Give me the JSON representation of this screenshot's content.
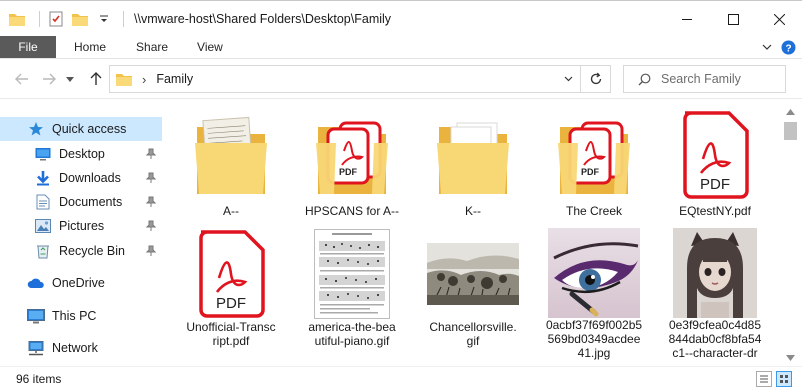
{
  "window": {
    "title": "\\\\vmware-host\\Shared Folders\\Desktop\\Family",
    "controls": [
      "minimize-icon",
      "maximize-icon",
      "close-icon"
    ]
  },
  "ribbon": {
    "tabs": [
      {
        "label": "File",
        "active": true
      },
      {
        "label": "Home"
      },
      {
        "label": "Share"
      },
      {
        "label": "View"
      }
    ]
  },
  "address": {
    "crumb": "Family",
    "separator": "›"
  },
  "search": {
    "placeholder": "Search Family"
  },
  "nav": {
    "items": [
      {
        "label": "Quick access",
        "icon": "star-icon",
        "selected": true
      },
      {
        "label": "Desktop",
        "icon": "desktop-icon",
        "pinned": true
      },
      {
        "label": "Downloads",
        "icon": "download-icon",
        "pinned": true
      },
      {
        "label": "Documents",
        "icon": "documents-icon",
        "pinned": true
      },
      {
        "label": "Pictures",
        "icon": "pictures-icon",
        "pinned": true
      },
      {
        "label": "Recycle Bin",
        "icon": "recycle-bin-icon",
        "pinned": true
      },
      {
        "label": "OneDrive",
        "icon": "cloud-icon"
      },
      {
        "label": "This PC",
        "icon": "computer-icon"
      },
      {
        "label": "Network",
        "icon": "network-icon"
      }
    ]
  },
  "files": [
    {
      "name": "A--",
      "kind": "folder-icon"
    },
    {
      "name": "HPSCANS for A--",
      "kind": "folder-pdf-icon"
    },
    {
      "name": "K--",
      "kind": "folder-icon"
    },
    {
      "name": "The Creek",
      "kind": "folder-pdf-icon"
    },
    {
      "name": "EQtestNY.pdf",
      "kind": "pdf-icon",
      "badge": "PDF"
    },
    {
      "name": "Unofficial-Transc\nript.pdf",
      "kind": "pdf-icon",
      "badge": "PDF"
    },
    {
      "name": "america-the-bea\nutiful-piano.gif",
      "kind": "sheet-music-thumbnail"
    },
    {
      "name": "Chancellorsville.\ngif",
      "kind": "battle-sketch-thumbnail"
    },
    {
      "name": "0acbf37f69f002b5\n569bd0349acdee\n41.jpg",
      "kind": "eye-makeup-thumbnail"
    },
    {
      "name": "0e3f9cfea0c4d85\n844dab0cf8bfa54\nc1--character-dr",
      "kind": "character-drawing-thumbnail"
    }
  ],
  "status": {
    "count": "96 items"
  },
  "colors": {
    "accent": "#0078d7",
    "selection": "#cce8ff",
    "file_tab": "#5a5a5a",
    "pdf_red": "#e0141e",
    "folder": "#f7d36b"
  }
}
